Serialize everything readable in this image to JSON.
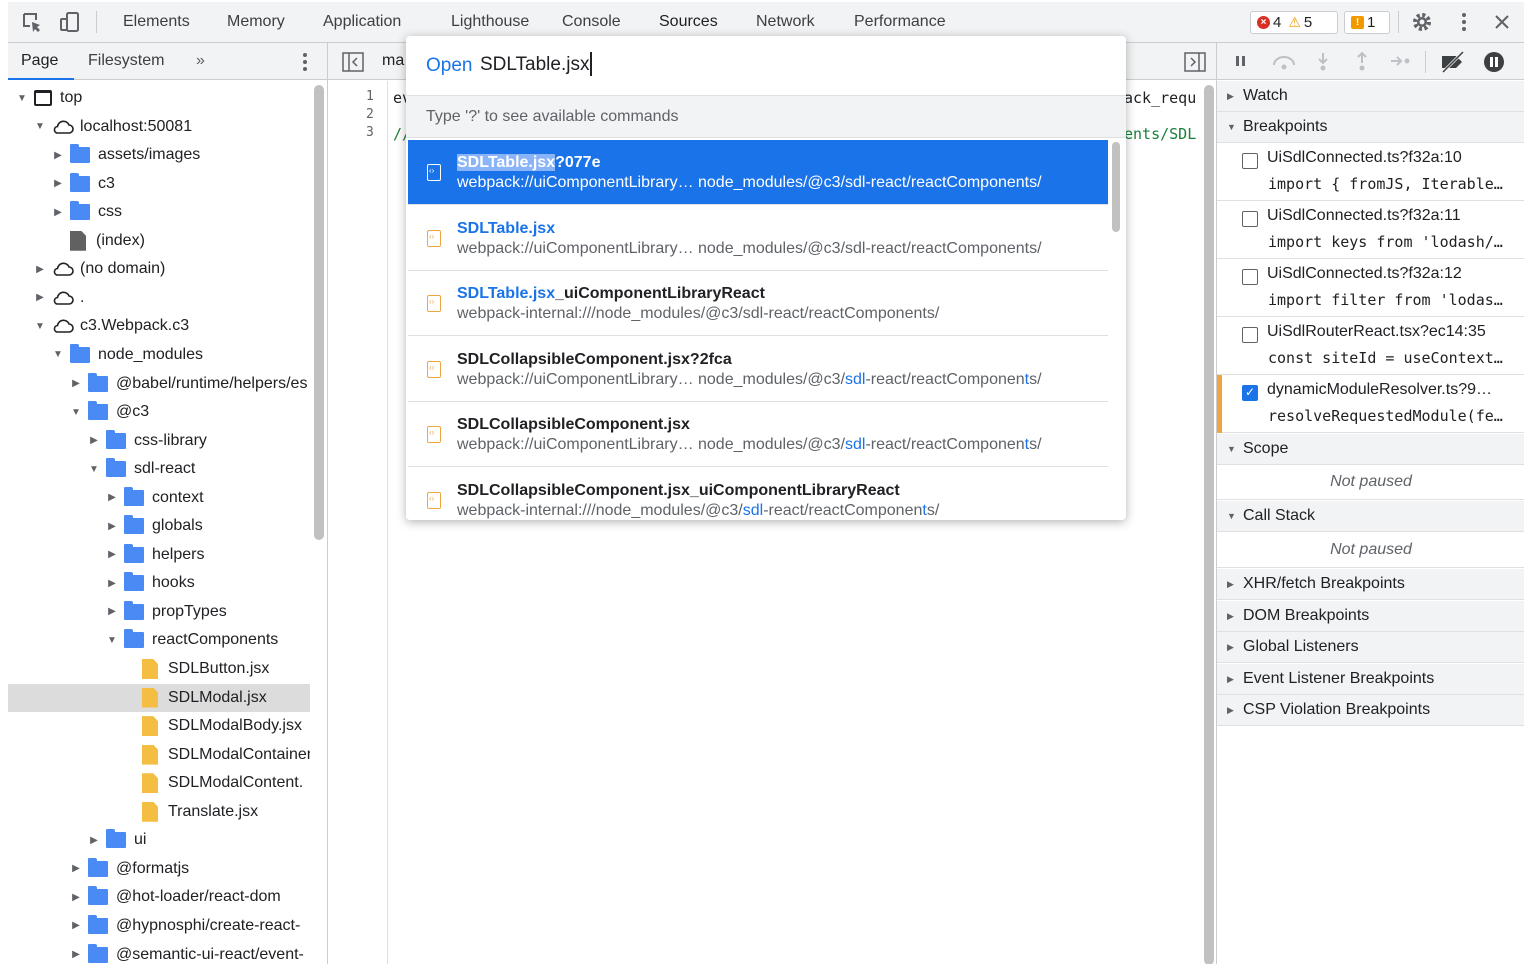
{
  "topbar": {
    "tabs": [
      "Elements",
      "Memory",
      "Application",
      "Lighthouse",
      "Console",
      "Sources",
      "Network",
      "Performance"
    ],
    "active_tab": "Sources",
    "errors": "4",
    "warnings": "5",
    "issues": "1"
  },
  "navigator": {
    "tabs": [
      "Page",
      "Filesystem"
    ],
    "more": "»",
    "tree": [
      {
        "label": "top",
        "kind": "frame",
        "depth": 0,
        "expanded": true
      },
      {
        "label": "localhost:50081",
        "kind": "cloud",
        "depth": 1,
        "expanded": true
      },
      {
        "label": "assets/images",
        "kind": "folder",
        "depth": 2,
        "expanded": false
      },
      {
        "label": "c3",
        "kind": "folder",
        "depth": 2,
        "expanded": false
      },
      {
        "label": "css",
        "kind": "folder",
        "depth": 2,
        "expanded": false
      },
      {
        "label": "(index)",
        "kind": "file-gray",
        "depth": 2,
        "expanded": null
      },
      {
        "label": "(no domain)",
        "kind": "cloud",
        "depth": 1,
        "expanded": false
      },
      {
        "label": ".",
        "kind": "cloud",
        "depth": 1,
        "expanded": false
      },
      {
        "label": "c3.Webpack.c3",
        "kind": "cloud",
        "depth": 1,
        "expanded": true
      },
      {
        "label": "node_modules",
        "kind": "folder",
        "depth": 2,
        "expanded": true
      },
      {
        "label": "@babel/runtime/helpers/es",
        "kind": "folder",
        "depth": 3,
        "expanded": false
      },
      {
        "label": "@c3",
        "kind": "folder",
        "depth": 3,
        "expanded": true
      },
      {
        "label": "css-library",
        "kind": "folder",
        "depth": 4,
        "expanded": false
      },
      {
        "label": "sdl-react",
        "kind": "folder",
        "depth": 4,
        "expanded": true
      },
      {
        "label": "context",
        "kind": "folder",
        "depth": 5,
        "expanded": false
      },
      {
        "label": "globals",
        "kind": "folder",
        "depth": 5,
        "expanded": false
      },
      {
        "label": "helpers",
        "kind": "folder",
        "depth": 5,
        "expanded": false
      },
      {
        "label": "hooks",
        "kind": "folder",
        "depth": 5,
        "expanded": false
      },
      {
        "label": "propTypes",
        "kind": "folder",
        "depth": 5,
        "expanded": false
      },
      {
        "label": "reactComponents",
        "kind": "folder",
        "depth": 5,
        "expanded": true
      },
      {
        "label": "SDLButton.jsx",
        "kind": "file-js",
        "depth": 6,
        "expanded": null
      },
      {
        "label": "SDLModal.jsx",
        "kind": "file-js",
        "depth": 6,
        "expanded": null,
        "selected": true
      },
      {
        "label": "SDLModalBody.jsx",
        "kind": "file-js",
        "depth": 6,
        "expanded": null
      },
      {
        "label": "SDLModalContainer",
        "kind": "file-js",
        "depth": 6,
        "expanded": null
      },
      {
        "label": "SDLModalContent.",
        "kind": "file-js",
        "depth": 6,
        "expanded": null
      },
      {
        "label": "Translate.jsx",
        "kind": "file-js",
        "depth": 6,
        "expanded": null
      },
      {
        "label": "ui",
        "kind": "folder",
        "depth": 4,
        "expanded": false
      },
      {
        "label": "@formatjs",
        "kind": "folder",
        "depth": 3,
        "expanded": false
      },
      {
        "label": "@hot-loader/react-dom",
        "kind": "folder",
        "depth": 3,
        "expanded": false
      },
      {
        "label": "@hypnosphi/create-react-",
        "kind": "folder",
        "depth": 3,
        "expanded": false
      },
      {
        "label": "@semantic-ui-react/event-",
        "kind": "folder",
        "depth": 3,
        "expanded": false
      }
    ]
  },
  "editor": {
    "tab_label": "ma",
    "lines": [
      {
        "n": "1",
        "text_left": "ev",
        "text_right": "ack_requ"
      },
      {
        "n": "2",
        "text_left": "",
        "text_right": ""
      },
      {
        "n": "3",
        "text_left": "//",
        "text_right": "ents/SDL"
      }
    ]
  },
  "quick_open": {
    "prefix": "Open",
    "query": "SDLTable.jsx",
    "hint": "Type '?' to see available commands",
    "items": [
      {
        "title_match": "SDLTable.jsx",
        "title_rest": "?077e",
        "path_pre": "webpack://uiComponentLibrary… node_modules/@c3/",
        "path_match": "",
        "path_mid": "sdl-react/reactComponents/",
        "path_match2": "",
        "path_post": "",
        "selected": true
      },
      {
        "title_match": "SDLTable.jsx",
        "title_rest": "",
        "path_pre": "webpack://uiComponentLibrary… node_modules/@c3/",
        "path_match": "",
        "path_mid": "sdl-react/reactComponents/",
        "path_match2": "",
        "path_post": "",
        "selected": false
      },
      {
        "title_match": "SDLTable.jsx",
        "title_rest": "_uiComponentLibraryReact",
        "path_pre": "webpack-internal:///node_modules/@c3/",
        "path_match": "",
        "path_mid": "sdl-react/reactComponents/",
        "path_match2": "",
        "path_post": "",
        "selected": false
      },
      {
        "title_match": "",
        "title_rest": "SDLCollapsibleComponent.jsx?2fca",
        "path_pre": "webpack://uiComponentLibrary… node_modules/@c3/",
        "path_match": "sdl",
        "path_mid": "-react/reactComponen",
        "path_match2": "t",
        "path_post": "s/",
        "selected": false
      },
      {
        "title_match": "",
        "title_rest": "SDLCollapsibleComponent.jsx",
        "path_pre": "webpack://uiComponentLibrary… node_modules/@c3/",
        "path_match": "sdl",
        "path_mid": "-react/reactComponen",
        "path_match2": "t",
        "path_post": "s/",
        "selected": false
      },
      {
        "title_match": "",
        "title_rest": "SDLCollapsibleComponent.jsx_uiComponentLibraryReact",
        "path_pre": "webpack-internal:///node_modules/@c3/",
        "path_match": "sdl",
        "path_mid": "-react/reactComponen",
        "path_match2": "t",
        "path_post": "s/",
        "selected": false
      }
    ]
  },
  "debugger": {
    "watch": "Watch",
    "breakpoints_title": "Breakpoints",
    "breakpoints": [
      {
        "file": "UiSdlConnected.ts?f32a:10",
        "code": "import { fromJS, Iterable…",
        "checked": false
      },
      {
        "file": "UiSdlConnected.ts?f32a:11",
        "code": "import keys from 'lodash/…",
        "checked": false
      },
      {
        "file": "UiSdlConnected.ts?f32a:12",
        "code": "import filter from 'lodas…",
        "checked": false
      },
      {
        "file": "UiSdlRouterReact.tsx?ec14:35",
        "code": "const siteId = useContext…",
        "checked": false
      },
      {
        "file": "dynamicModuleResolver.ts?9…",
        "code": "resolveRequestedModule(fe…",
        "checked": true
      }
    ],
    "scope_title": "Scope",
    "scope_status": "Not paused",
    "callstack_title": "Call Stack",
    "callstack_status": "Not paused",
    "collapsed_sections": [
      "XHR/fetch Breakpoints",
      "DOM Breakpoints",
      "Global Listeners",
      "Event Listener Breakpoints",
      "CSP Violation Breakpoints"
    ]
  },
  "colors": {
    "accent": "#1a73e8",
    "folder": "#4a8af4",
    "js_file": "#f3be41",
    "breakpoint_marker": "#f0a640"
  }
}
